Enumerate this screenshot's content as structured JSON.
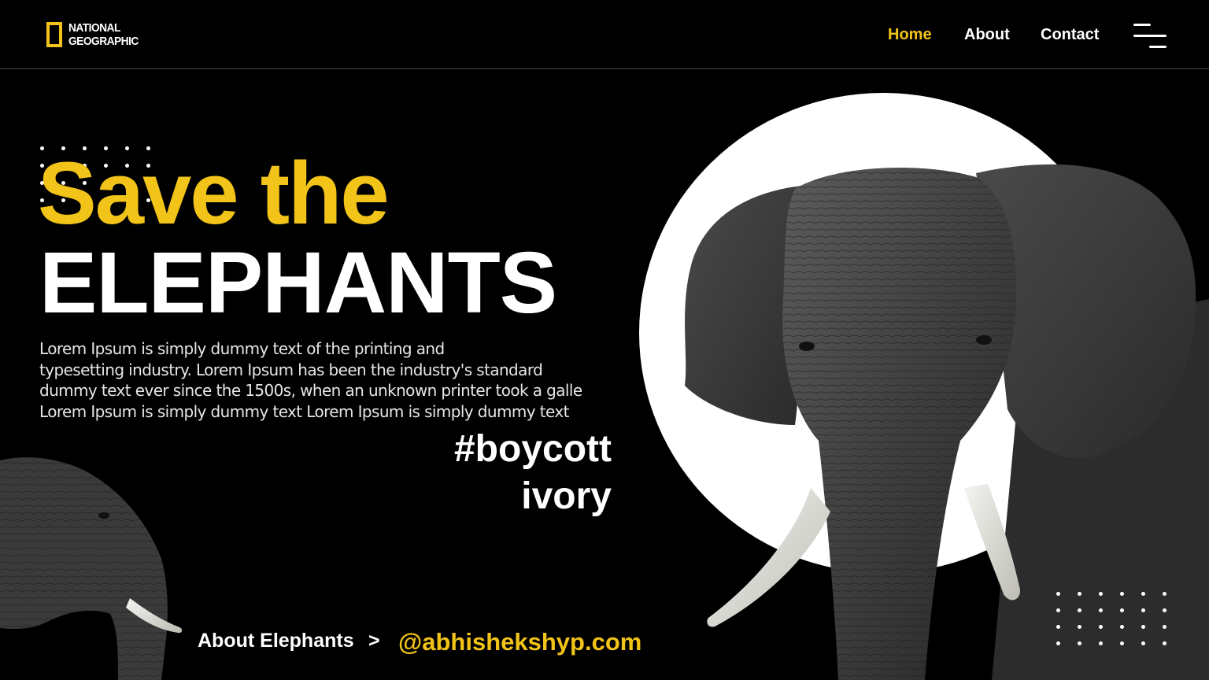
{
  "brand": {
    "line1": "NATIONAL",
    "line2": "GEOGRAPHIC",
    "accent": "#f2c318"
  },
  "nav": [
    {
      "label": "Home",
      "active": true
    },
    {
      "label": "About",
      "active": false
    },
    {
      "label": "Contact",
      "active": false
    }
  ],
  "menu_icon": "hamburger-menu-icon",
  "hero": {
    "title_line1": "Save the",
    "title_line2": "ELEPHANTS",
    "description": [
      "Lorem Ipsum is simply dummy text of the printing and",
      "typesetting industry. Lorem Ipsum has been the industry's standard",
      "dummy text ever since the 1500s, when an unknown printer took a galle",
      "Lorem Ipsum is simply dummy text  Lorem Ipsum is simply dummy text"
    ],
    "hashtag_line1": "#boycott",
    "hashtag_line2": "ivory"
  },
  "footer": {
    "about_label": "About Elephants",
    "separator": ">",
    "handle": "@abhishekshyp.com"
  },
  "colors": {
    "background": "#000000",
    "accent": "#f2c318",
    "text": "#ffffff"
  }
}
